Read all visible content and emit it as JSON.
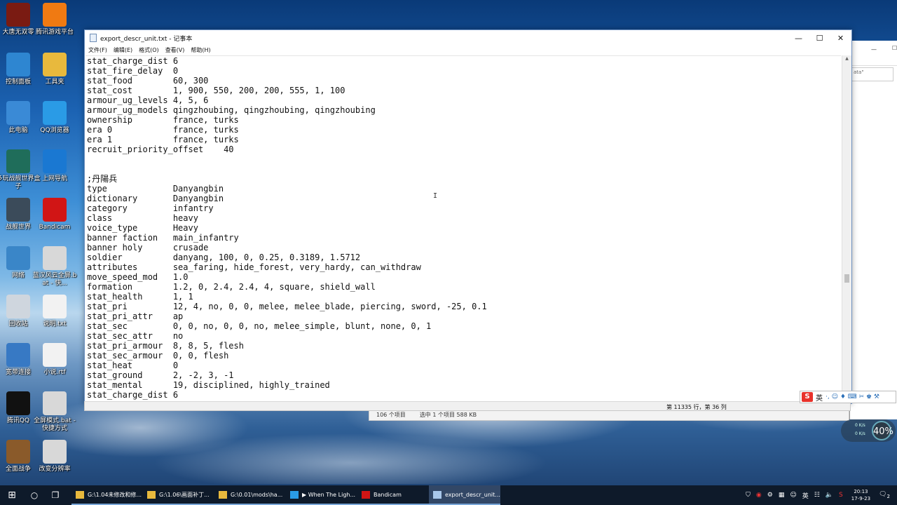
{
  "desktop_icons": [
    {
      "label": "大唐无双零",
      "color": "#7a1b12"
    },
    {
      "label": "腾讯游戏平台",
      "color": "#f07a12"
    },
    {
      "label": "控制面板",
      "color": "#2e86d1"
    },
    {
      "label": "工具夹",
      "color": "#e8b93d"
    },
    {
      "label": "此电脑",
      "color": "#3a8ad6"
    },
    {
      "label": "QQ浏览器",
      "color": "#2a9be6"
    },
    {
      "label": "多玩战舰世界盒子",
      "color": "#1f6d5a"
    },
    {
      "label": "上网导航",
      "color": "#1a78d2"
    },
    {
      "label": "战舰世界",
      "color": "#3b4b5a"
    },
    {
      "label": "Bandicam",
      "color": "#d11515"
    },
    {
      "label": "网络",
      "color": "#3a86c8"
    },
    {
      "label": "蓝汉风云全屏.bat - 快...",
      "color": "#d8d8d8"
    },
    {
      "label": "回收站",
      "color": "#cfd6de"
    },
    {
      "label": "说明.txt",
      "color": "#f2f2f2"
    },
    {
      "label": "宽带连接",
      "color": "#3779c4"
    },
    {
      "label": "小说.rtf",
      "color": "#f2f2f2"
    },
    {
      "label": "腾讯QQ",
      "color": "#111111"
    },
    {
      "label": "全屏模式.bat - 快捷方式",
      "color": "#d8d8d8"
    },
    {
      "label": "全面战争",
      "color": "#8a5a2a"
    },
    {
      "label": "改变分辨率",
      "color": "#d8d8d8"
    }
  ],
  "notepad": {
    "title": "export_descr_unit.txt - 记事本",
    "menu": [
      "文件(F)",
      "编辑(E)",
      "格式(O)",
      "查看(V)",
      "帮助(H)"
    ],
    "lines": [
      "stat_charge_dist 6",
      "stat_fire_delay  0",
      "stat_food        60, 300",
      "stat_cost        1, 900, 550, 200, 200, 555, 1, 100",
      "armour_ug_levels 4, 5, 6",
      "armour_ug_models qingzhoubing, qingzhoubing, qingzhoubing",
      "ownership        france, turks",
      "era 0            france, turks",
      "era 1            france, turks",
      "recruit_priority_offset    40",
      "",
      "",
      ";丹陽兵",
      "type             Danyangbin",
      "dictionary       Danyangbin",
      "category         infantry",
      "class            heavy",
      "voice_type       Heavy",
      "banner faction   main_infantry",
      "banner holy      crusade",
      "soldier          danyang, 100, 0, 0.25, 0.3189, 1.5712",
      "attributes       sea_faring, hide_forest, very_hardy, can_withdraw",
      "move_speed_mod   1.0",
      "formation        1.2, 0, 2.4, 2.4, 4, square, shield_wall",
      "stat_health      1, 1",
      "stat_pri         12, 4, no, 0, 0, melee, melee_blade, piercing, sword, -25, 0.1",
      "stat_pri_attr    ap",
      "stat_sec         0, 0, no, 0, 0, no, melee_simple, blunt, none, 0, 1",
      "stat_sec_attr    no",
      "stat_pri_armour  8, 8, 5, flesh",
      "stat_sec_armour  0, 0, flesh",
      "stat_heat        0",
      "stat_ground      2, -2, 3, -1",
      "stat_mental      19, disciplined, highly_trained",
      "stat_charge_dist 6"
    ],
    "status_position": "第 11335 行，第 36 列"
  },
  "explorer_status": {
    "items": "106 个项目",
    "selected": "选中 1 个项目  588 KB"
  },
  "back_window": {
    "text": "ata\""
  },
  "ime": {
    "logo": "S",
    "lang": "英",
    "symbols": "·, ☺ ♦ ⌨ ✂ ♚ ⚒"
  },
  "speed": {
    "up": "0 K/s",
    "down": "0 K/s",
    "percent": "40%"
  },
  "taskbar": {
    "tasks": [
      {
        "label": "G:\\1.04未修改和修...",
        "icon_color": "#e8b93d"
      },
      {
        "label": "G:\\1.06\\画面补丁...",
        "icon_color": "#e8b93d"
      },
      {
        "label": "G:\\0.01\\mods\\ha...",
        "icon_color": "#e8b93d"
      },
      {
        "label": "▶ When The Ligh...",
        "icon_color": "#2a9be6"
      },
      {
        "label": "Bandicam",
        "icon_color": "#d11515"
      },
      {
        "label": "export_descr_unit...",
        "icon_color": "#a9c7ea"
      }
    ],
    "tray_lang": "英",
    "time": "20:13",
    "date": "17-9-23",
    "notif_count": "2"
  }
}
